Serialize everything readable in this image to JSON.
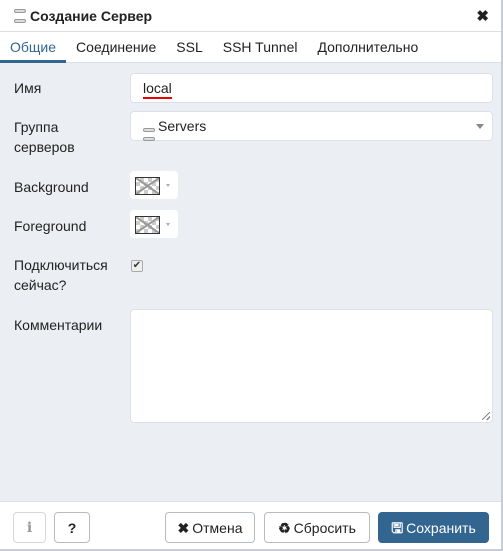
{
  "dialog": {
    "title": "Создание Сервер",
    "title_icon": "server-icon",
    "close_icon": "close-icon",
    "close_glyph": "✖"
  },
  "tabs": [
    {
      "label": "Общие",
      "active": true
    },
    {
      "label": "Соединение",
      "active": false
    },
    {
      "label": "SSL",
      "active": false
    },
    {
      "label": "SSH Tunnel",
      "active": false
    },
    {
      "label": "Дополнительно",
      "active": false
    }
  ],
  "form": {
    "name_label": "Имя",
    "name_value": "local",
    "group_label_line1": "Группа",
    "group_label_line2": "серверов",
    "group_value": "Servers",
    "background_label": "Background",
    "foreground_label": "Foreground",
    "connect_label_line1": "Подключиться",
    "connect_label_line2": "сейчас?",
    "connect_checked": true,
    "check_glyph": "✔",
    "comments_label": "Комментарии",
    "comments_value": ""
  },
  "footer": {
    "info_glyph": "i",
    "help_glyph": "?",
    "cancel_icon": "✖",
    "cancel_label": "Отмена",
    "reset_icon": "♻",
    "reset_label": "Сбросить",
    "save_icon": "🖫",
    "save_label": "Сохранить"
  },
  "colors": {
    "accent": "#326690",
    "body_bg": "#ebeef3",
    "spellcheck_underline": "#e00000"
  }
}
